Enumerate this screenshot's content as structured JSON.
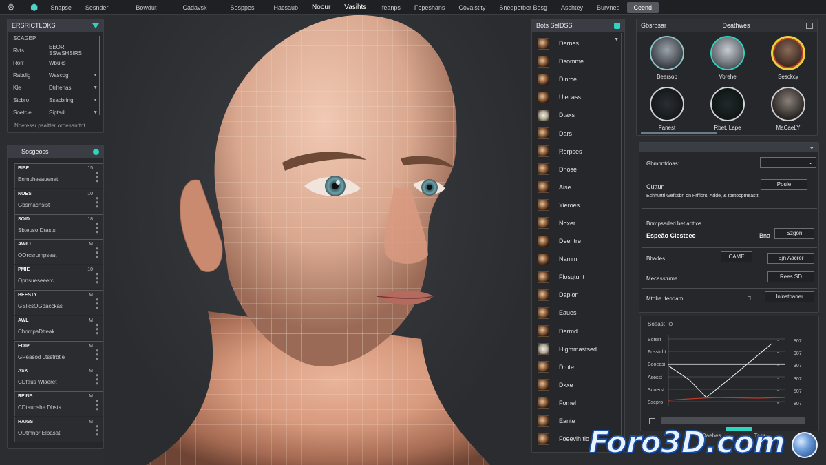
{
  "menubar": {
    "brand": "Snapse",
    "items": [
      "Sesnder",
      "Bowdut",
      "Cadavsk",
      "Sesppes",
      "Hacsaub",
      "Noour",
      "Vasihts",
      "Ifeanps",
      "Fepeshans",
      "Covalstity",
      "Snedpetber Bosg",
      "Asshtey",
      "Burvned",
      "Ceend"
    ],
    "active": "Ceend"
  },
  "scene_panel": {
    "title": "ERSRICTLOKS",
    "subtitle": "SCAGEP",
    "rows": [
      {
        "k": "Rvts",
        "v": "EEOR SSWSHSIRS"
      },
      {
        "k": "Rorr",
        "v": "Wbuks"
      },
      {
        "k": "Rabdig",
        "v": "Wascdg"
      },
      {
        "k": "Kle",
        "v": "Dtrhenas"
      },
      {
        "k": "Stcbro",
        "v": "Ssacbring"
      },
      {
        "k": "Soetcle",
        "v": "Siptad"
      }
    ],
    "note": "Noetessr psaltter oroesanttnt"
  },
  "segment_panel": {
    "title": "Sosgeoss",
    "items": [
      {
        "code": "BISF",
        "tag": "15",
        "desc": "Enmuhesauenat"
      },
      {
        "code": "NOES",
        "tag": "10",
        "desc": "Gbsmacnsist"
      },
      {
        "code": "SOID",
        "tag": "18",
        "desc": "Sbteuso Drasts"
      },
      {
        "code": "AWIO",
        "tag": "M",
        "desc": "OOrcsrumpseat"
      },
      {
        "code": "PMIE",
        "tag": "10",
        "desc": "Opnsueseeerc"
      },
      {
        "code": "BEESTY",
        "tag": "M",
        "desc": "GSlicsOGbacckas"
      },
      {
        "code": "AWL",
        "tag": "M",
        "desc": "ChompaDtteak"
      },
      {
        "code": "EOIP",
        "tag": "M",
        "desc": "GPeasod Ltsstrbtle"
      },
      {
        "code": "ASK",
        "tag": "M",
        "desc": "CDfaus Wlaeret"
      },
      {
        "code": "REINS",
        "tag": "M",
        "desc": "CDtaupshe Dhsts"
      },
      {
        "code": "RAIGS",
        "tag": "M",
        "desc": "ODtmnpr Elbasat"
      }
    ]
  },
  "materials": {
    "title": "Bots SeIDSS",
    "items": [
      "Dernes",
      "Dsomme",
      "Dinrce",
      "Ulecass",
      "Dtaxs",
      "Dars",
      "Rorpses",
      "Dnose",
      "Aise",
      "Yieroes",
      "Noxer",
      "Deentre",
      "Namm",
      "Flosgtunt",
      "Dapion",
      "Eaues",
      "Dermd",
      "Higmmastsed",
      "Drote",
      "Dkxe",
      "Fomel",
      "Eante",
      "Foeevih tio"
    ]
  },
  "presets": {
    "title": "Gbsrbsar",
    "title2": "Deathwes",
    "heads": [
      {
        "label": "Beersob",
        "style": "gray"
      },
      {
        "label": "Vorehe",
        "style": "teal"
      },
      {
        "label": "Sesckcy",
        "style": "red"
      },
      {
        "label": "Fanest",
        "style": "dark"
      },
      {
        "label": "Rbet. Lape",
        "style": "dark2"
      },
      {
        "label": "MaCaeLY",
        "style": "dark3"
      }
    ]
  },
  "settings": {
    "label1": "Gbmnntdoas:",
    "label2": "Cuttun",
    "btn2": "Poule",
    "desc2": "Echhutttl Gefssbn on Frfficnt. Adde, & tbetocpmeastt.",
    "sec_title": "Bnmpsaded bet.adttos",
    "sec_name": "Espeão Clesteec",
    "sec_sub": "Bna",
    "sec_btn": "Szgon",
    "row1_label": "Bbades",
    "row1_btn": "CAME",
    "row1_btn2": "Ejn Aacrer",
    "row2_label": "Mecasstume",
    "row2_btn": "Rees SD",
    "row3_label": "Mtobe Iteodam",
    "row3_btn": "Ininstbaner"
  },
  "graph": {
    "title": "Soeast",
    "rows": [
      "Sotsst",
      "Fosstcht",
      "Booeasi",
      "Asesst",
      "Suoerst",
      "Ssepro"
    ],
    "values": [
      "807",
      "987",
      "307",
      "307",
      "507",
      "807"
    ]
  },
  "bottom": {
    "tab1": "Daebes",
    "tab2": "Toas"
  },
  "watermark": "Foro3D.com"
}
